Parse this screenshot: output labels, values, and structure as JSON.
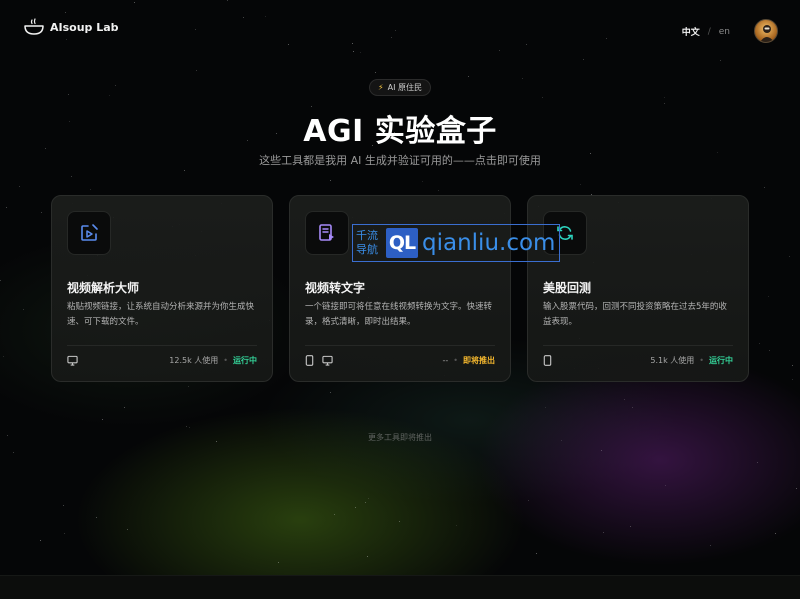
{
  "header": {
    "logo_text": "AIsoup Lab",
    "lang_zh": "中文",
    "lang_sep": "/",
    "lang_en": "en"
  },
  "hero": {
    "badge": "AI 原住民",
    "title": "AGI 实验盒子",
    "subtitle": "这些工具都是我用 AI 生成并验证可用的——点击即可使用"
  },
  "cards": [
    {
      "title": "视频解析大师",
      "desc": "粘贴视频链接，让系统自动分析来源并为你生成快速、可下载的文件。",
      "icon": "video-edit-icon",
      "devices": [
        "desktop-icon"
      ],
      "users": "12.5k 人使用",
      "status": "运行中",
      "status_color": "#34d399"
    },
    {
      "title": "视频转文字",
      "desc": "一个链接即可将任意在线视频转换为文字。快速转录，格式清晰，即时出结果。",
      "icon": "transcript-icon",
      "devices": [
        "mobile-icon",
        "desktop-icon"
      ],
      "users": "--",
      "status": "即将推出",
      "status_color": "#f5b82e"
    },
    {
      "title": "美股回测",
      "desc": "输入股票代码，回测不同投资策略在过去5年的收益表现。",
      "icon": "refresh-icon",
      "devices": [
        "mobile-icon"
      ],
      "users": "5.1k 人使用",
      "status": "运行中",
      "status_color": "#34d399"
    }
  ],
  "footer": {
    "more": "更多工具即将推出"
  },
  "watermark": {
    "cn": "千流导航",
    "ql": "QL",
    "url": "qianliu.com"
  },
  "colors": {
    "accent_green": "#34d399",
    "accent_yellow": "#f5b82e",
    "icon_blue": "#5b8def",
    "icon_purple": "#a78bfa",
    "icon_teal": "#2dd4bf"
  }
}
